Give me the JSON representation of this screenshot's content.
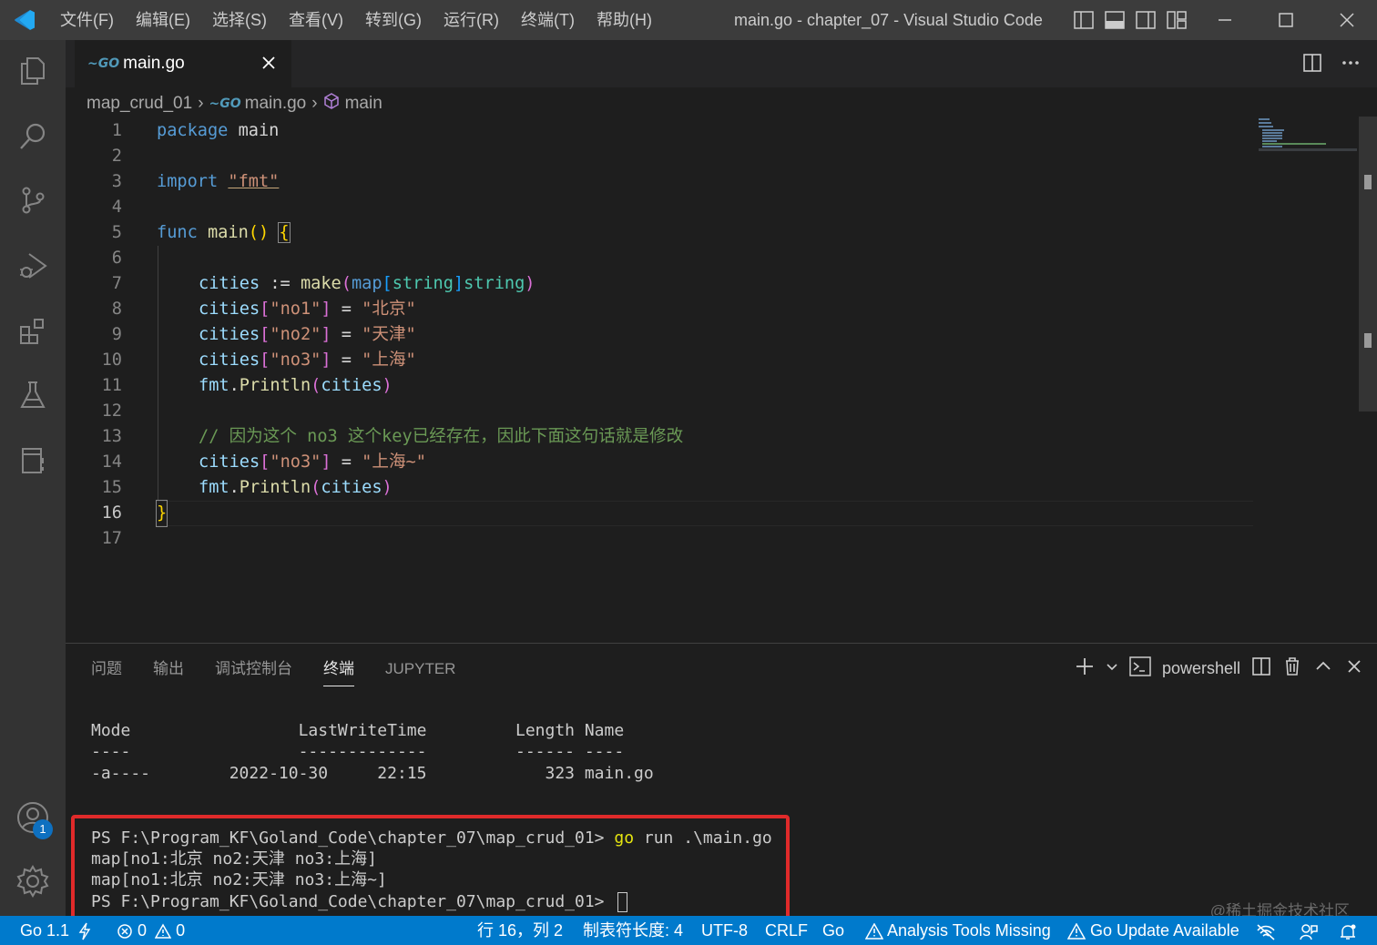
{
  "titlebar": {
    "menu": [
      "文件(F)",
      "编辑(E)",
      "选择(S)",
      "查看(V)",
      "转到(G)",
      "运行(R)",
      "终端(T)",
      "帮助(H)"
    ],
    "window_title": "main.go - chapter_07 - Visual Studio Code"
  },
  "tab": {
    "label": "main.go",
    "icon": "go-icon"
  },
  "breadcrumb": {
    "folder": "map_crud_01",
    "file": "main.go",
    "symbol": "main"
  },
  "editor": {
    "line_numbers": [
      "1",
      "2",
      "3",
      "4",
      "5",
      "6",
      "7",
      "8",
      "9",
      "10",
      "11",
      "12",
      "13",
      "14",
      "15",
      "16",
      "17"
    ],
    "active_line": "16",
    "lines": {
      "l1": [
        "package",
        " main"
      ],
      "l3": [
        "import",
        " ",
        "\"fmt\""
      ],
      "l5": [
        "func",
        " ",
        "main",
        "()",
        " ",
        "{"
      ],
      "l7": [
        "cities",
        " := ",
        "make",
        "(",
        "map",
        "[",
        "string",
        "]",
        "string",
        ")"
      ],
      "l8": [
        "cities",
        "[",
        "\"no1\"",
        "]",
        " = ",
        "\"北京\""
      ],
      "l9": [
        "cities",
        "[",
        "\"no2\"",
        "]",
        " = ",
        "\"天津\""
      ],
      "l10": [
        "cities",
        "[",
        "\"no3\"",
        "]",
        " = ",
        "\"上海\""
      ],
      "l11": [
        "fmt",
        ".",
        "Println",
        "(",
        "cities",
        ")"
      ],
      "l13": "// 因为这个 no3 这个key已经存在，因此下面这句话就是修改",
      "l14": [
        "cities",
        "[",
        "\"no3\"",
        "]",
        " = ",
        "\"上海~\""
      ],
      "l15": [
        "fmt",
        ".",
        "Println",
        "(",
        "cities",
        ")"
      ],
      "l16": "}"
    }
  },
  "panel": {
    "tabs": [
      "问题",
      "输出",
      "调试控制台",
      "终端",
      "JUPYTER"
    ],
    "active_tab": "终端",
    "terminal_name": "powershell",
    "terminal": {
      "header": "Mode                 LastWriteTime         Length Name",
      "underline": "----                 -------------         ------ ----",
      "row": "-a----        2022-10-30     22:15            323 main.go",
      "prompt1": "PS F:\\Program_KF\\Goland_Code\\chapter_07\\map_crud_01> ",
      "cmd_go": "go",
      "cmd_rest": " run .\\main.go",
      "out1": "map[no1:北京 no2:天津 no3:上海]",
      "out2": "map[no1:北京 no2:天津 no3:上海~]",
      "prompt2": "PS F:\\Program_KF\\Goland_Code\\chapter_07\\map_crud_01> "
    }
  },
  "accounts_badge": "1",
  "statusbar": {
    "go_version": "Go 1.1",
    "errors": "0",
    "warnings": "0",
    "position": "行 16，列 2",
    "tab_size": "制表符长度: 4",
    "encoding": "UTF-8",
    "eol": "CRLF",
    "language": "Go",
    "analysis": "Analysis Tools Missing",
    "update": "Go Update Available"
  },
  "watermark": "@稀土掘金技术社区",
  "colors": {
    "statusbar": "#007acc",
    "highlight_box": "#e02a2a",
    "accent": "#0e70c0"
  }
}
